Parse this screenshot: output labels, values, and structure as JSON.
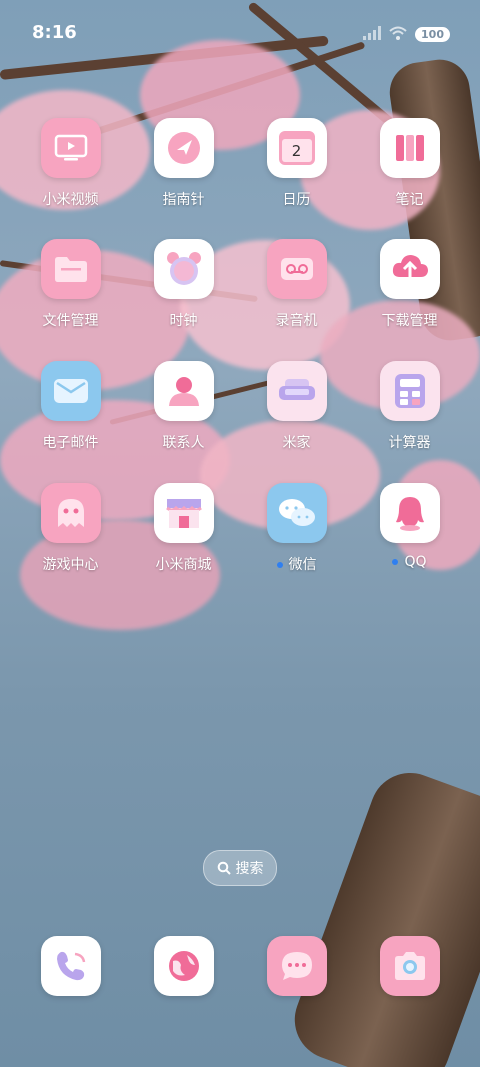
{
  "status_bar": {
    "time": "8:16",
    "battery": "100",
    "icons": [
      "signal-icon",
      "wifi-icon",
      "battery-icon"
    ]
  },
  "apps": [
    {
      "label": "小米视频",
      "icon": "video-icon",
      "bg": "#f7a4c0"
    },
    {
      "label": "指南针",
      "icon": "compass-icon",
      "bg": "#ffffff"
    },
    {
      "label": "日历",
      "icon": "calendar-icon",
      "bg": "#ffffff",
      "badge": "2"
    },
    {
      "label": "笔记",
      "icon": "notes-icon",
      "bg": "#ffffff"
    },
    {
      "label": "文件管理",
      "icon": "folder-icon",
      "bg": "#f7a4c0"
    },
    {
      "label": "时钟",
      "icon": "alarm-clock-icon",
      "bg": "#ffffff"
    },
    {
      "label": "录音机",
      "icon": "recorder-icon",
      "bg": "#f7a4c0"
    },
    {
      "label": "下载管理",
      "icon": "cloud-download-icon",
      "bg": "#ffffff"
    },
    {
      "label": "电子邮件",
      "icon": "mail-icon",
      "bg": "#8cc8ee"
    },
    {
      "label": "联系人",
      "icon": "contact-icon",
      "bg": "#ffffff"
    },
    {
      "label": "米家",
      "icon": "sofa-icon",
      "bg": "#fbe3ee"
    },
    {
      "label": "计算器",
      "icon": "calculator-icon",
      "bg": "#fbe3ee"
    },
    {
      "label": "游戏中心",
      "icon": "ghost-icon",
      "bg": "#f7a4c0"
    },
    {
      "label": "小米商城",
      "icon": "store-icon",
      "bg": "#ffffff"
    },
    {
      "label": "微信",
      "icon": "wechat-icon",
      "bg": "#8cc8ee",
      "new_dot": true
    },
    {
      "label": "QQ",
      "icon": "qq-penguin-icon",
      "bg": "#ffffff",
      "new_dot": true
    }
  ],
  "search": {
    "label": "搜索"
  },
  "dock": [
    {
      "icon": "phone-icon",
      "bg": "#ffffff"
    },
    {
      "icon": "browser-globe-icon",
      "bg": "#ffffff"
    },
    {
      "icon": "message-icon",
      "bg": "#f7a4c0"
    },
    {
      "icon": "camera-icon",
      "bg": "#f7a4c0"
    }
  ],
  "colors": {
    "accent_pink": "#f06c98",
    "notify_dot": "#2f7ff0"
  }
}
